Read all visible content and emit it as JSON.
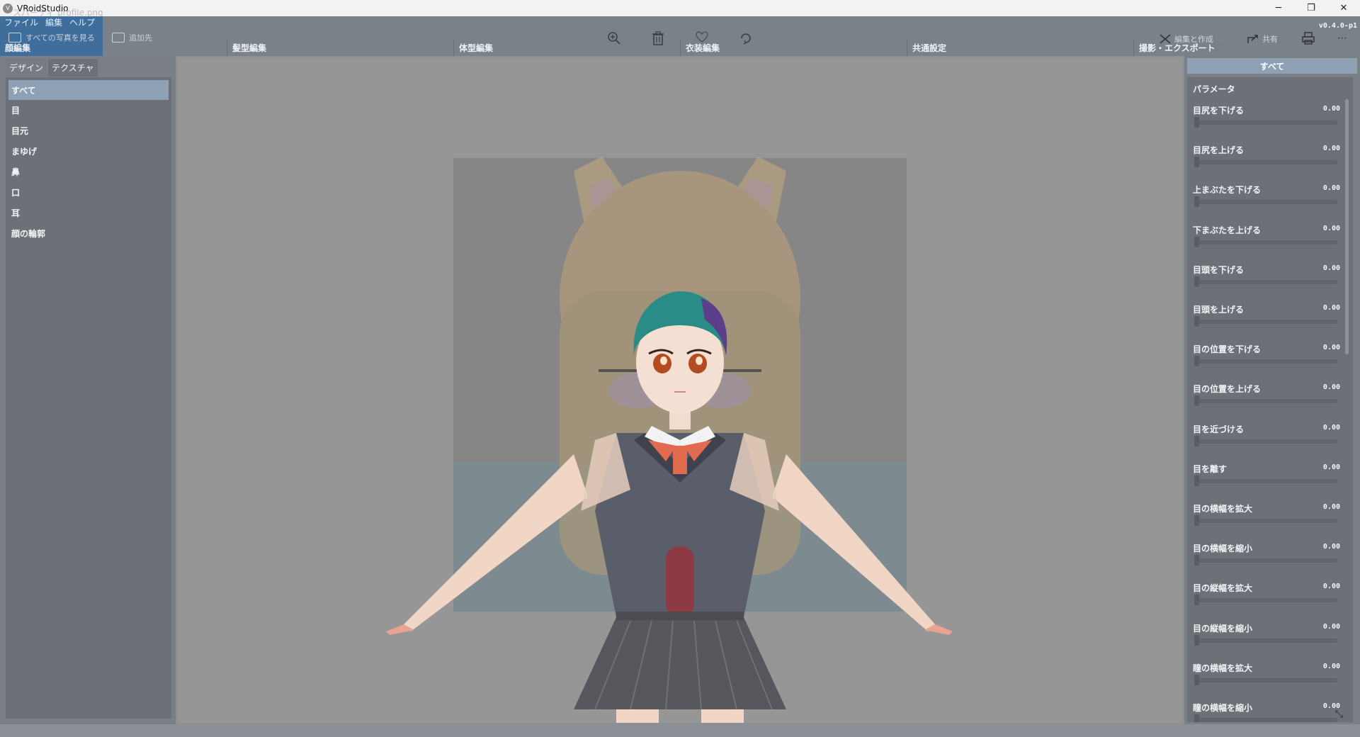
{
  "window": {
    "title": "VRoidStudio",
    "ghost_title": "スパーティ profile.png",
    "minimize": "─",
    "maximize": "❐",
    "close": "✕"
  },
  "menu": [
    "ファイル",
    "編集",
    "ヘルプ"
  ],
  "overlay": {
    "view_all_photos": "すべての写真を見る",
    "add_to": "追加先",
    "edit_create": "編集と作成",
    "share": "共有",
    "more": "⋯"
  },
  "main_tabs": [
    "顔編集",
    "髪型編集",
    "体型編集",
    "衣装編集",
    "共通設定",
    "撮影・エクスポート"
  ],
  "version": "v0.4.0-p1",
  "left_panel": {
    "subtabs": [
      "デザイン",
      "テクスチャ"
    ],
    "items": [
      "すべて",
      "目",
      "目元",
      "まゆげ",
      "鼻",
      "口",
      "耳",
      "顔の輪郭"
    ]
  },
  "right_panel": {
    "tab": "すべて",
    "section": "パラメータ",
    "params": [
      {
        "label": "目尻を下げる",
        "value": "0.00"
      },
      {
        "label": "目尻を上げる",
        "value": "0.00"
      },
      {
        "label": "上まぶたを下げる",
        "value": "0.00"
      },
      {
        "label": "下まぶたを上げる",
        "value": "0.00"
      },
      {
        "label": "目頭を下げる",
        "value": "0.00"
      },
      {
        "label": "目頭を上げる",
        "value": "0.00"
      },
      {
        "label": "目の位置を下げる",
        "value": "0.00"
      },
      {
        "label": "目の位置を上げる",
        "value": "0.00"
      },
      {
        "label": "目を近づける",
        "value": "0.00"
      },
      {
        "label": "目を離す",
        "value": "0.00"
      },
      {
        "label": "目の横幅を拡大",
        "value": "0.00"
      },
      {
        "label": "目の横幅を縮小",
        "value": "0.00"
      },
      {
        "label": "目の縦幅を拡大",
        "value": "0.00"
      },
      {
        "label": "目の縦幅を縮小",
        "value": "0.00"
      },
      {
        "label": "瞳の横幅を拡大",
        "value": "0.00"
      },
      {
        "label": "瞳の横幅を縮小",
        "value": "0.00"
      }
    ]
  },
  "colors": {
    "active_tab": "#3f6d9c",
    "selected_item": "#8ea0b4",
    "panel": "#6c7178",
    "viewport": "#969696"
  }
}
